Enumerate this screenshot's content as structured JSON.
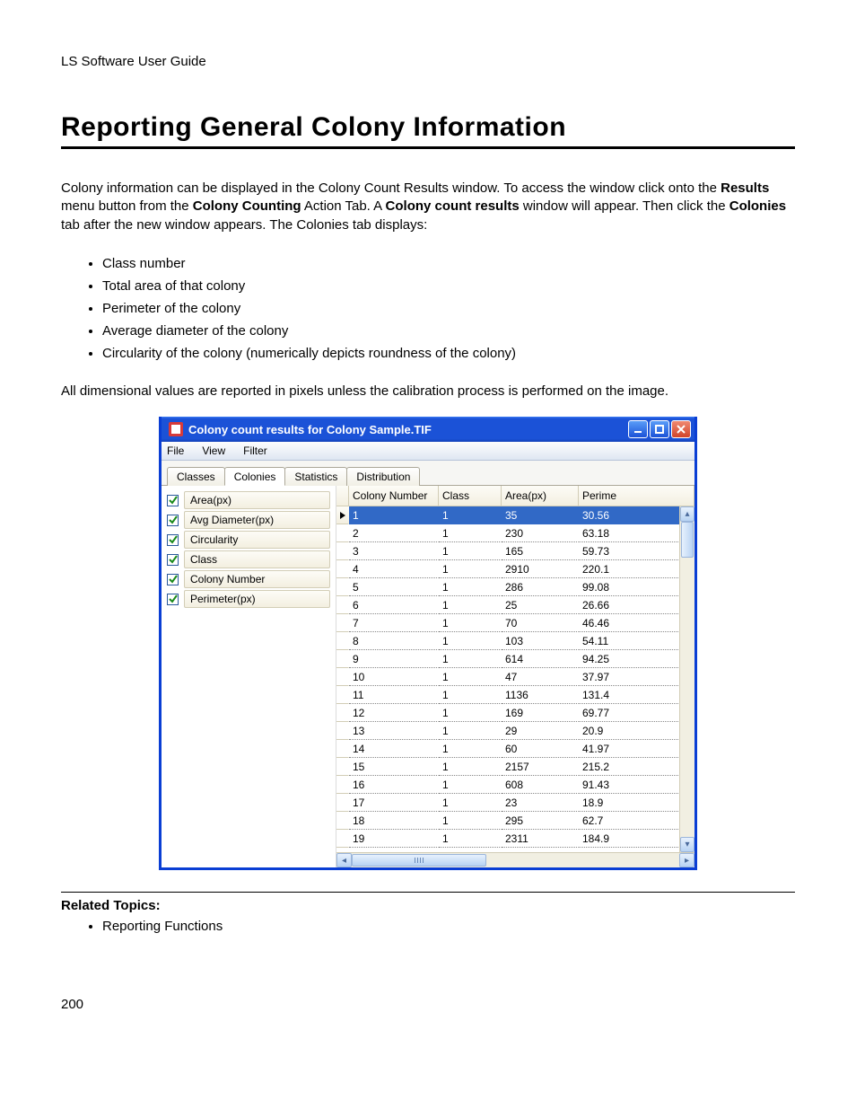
{
  "doc": {
    "header": "LS Software User Guide",
    "title": "Reporting General Colony Information",
    "intro_pre": "Colony information can be displayed in the Colony Count Results window.  To access the window click onto the ",
    "intro_b1": "Results",
    "intro_mid1": " menu button from the ",
    "intro_b2": "Colony Counting",
    "intro_mid2": " Action Tab. A ",
    "intro_b3": "Colony count results",
    "intro_mid3": " window will appear.  Then click the ",
    "intro_b4": "Colonies",
    "intro_post": " tab after the new window appears.  The Colonies tab displays:",
    "bullets": [
      "Class number",
      "Total area of that colony",
      "Perimeter of the colony",
      "Average diameter of the colony",
      "Circularity of the colony (numerically depicts roundness of the colony)"
    ],
    "after": "All dimensional values are reported in pixels unless the calibration process is performed on the image.",
    "related_label": "Related Topics:",
    "related_items": [
      "Reporting Functions"
    ],
    "page_number": "200"
  },
  "window": {
    "title": "Colony count results for Colony Sample.TIF",
    "menus": [
      "File",
      "View",
      "Filter"
    ],
    "tabs": [
      "Classes",
      "Colonies",
      "Statistics",
      "Distribution"
    ],
    "active_tab": 1,
    "left_props": [
      "Area(px)",
      "Avg Diameter(px)",
      "Circularity",
      "Class",
      "Colony Number",
      "Perimeter(px)"
    ],
    "columns": [
      "Colony Number",
      "Class",
      "Area(px)",
      "Perime"
    ],
    "rows": [
      {
        "n": "1",
        "cls": "1",
        "area": "35",
        "perim": "30.56",
        "sel": true
      },
      {
        "n": "2",
        "cls": "1",
        "area": "230",
        "perim": "63.18"
      },
      {
        "n": "3",
        "cls": "1",
        "area": "165",
        "perim": "59.73"
      },
      {
        "n": "4",
        "cls": "1",
        "area": "2910",
        "perim": "220.1"
      },
      {
        "n": "5",
        "cls": "1",
        "area": "286",
        "perim": "99.08"
      },
      {
        "n": "6",
        "cls": "1",
        "area": "25",
        "perim": "26.66"
      },
      {
        "n": "7",
        "cls": "1",
        "area": "70",
        "perim": "46.46"
      },
      {
        "n": "8",
        "cls": "1",
        "area": "103",
        "perim": "54.11"
      },
      {
        "n": "9",
        "cls": "1",
        "area": "614",
        "perim": "94.25"
      },
      {
        "n": "10",
        "cls": "1",
        "area": "47",
        "perim": "37.97"
      },
      {
        "n": "11",
        "cls": "1",
        "area": "1136",
        "perim": "131.4"
      },
      {
        "n": "12",
        "cls": "1",
        "area": "169",
        "perim": "69.77"
      },
      {
        "n": "13",
        "cls": "1",
        "area": "29",
        "perim": "20.9"
      },
      {
        "n": "14",
        "cls": "1",
        "area": "60",
        "perim": "41.97"
      },
      {
        "n": "15",
        "cls": "1",
        "area": "2157",
        "perim": "215.2"
      },
      {
        "n": "16",
        "cls": "1",
        "area": "608",
        "perim": "91.43"
      },
      {
        "n": "17",
        "cls": "1",
        "area": "23",
        "perim": "18.9"
      },
      {
        "n": "18",
        "cls": "1",
        "area": "295",
        "perim": "62.7"
      },
      {
        "n": "19",
        "cls": "1",
        "area": "2311",
        "perim": "184.9"
      }
    ]
  }
}
